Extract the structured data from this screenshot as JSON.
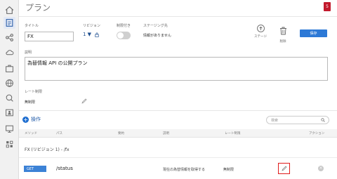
{
  "header": {
    "title": "プラン",
    "notification_count": "5"
  },
  "nav": {
    "items": [
      "home-icon",
      "plan-icon",
      "share-icon",
      "cloud-icon",
      "bag-icon",
      "globe-icon",
      "search-person-icon",
      "user-card-icon",
      "monitor-icon",
      "puzzle-icon"
    ]
  },
  "form": {
    "title_label": "タイトル",
    "title_value": "FX",
    "revision_label": "リビジョン",
    "revision_value": "1 ▼",
    "limited_label": "制限付き",
    "staging_label": "ステージング先",
    "staging_value": "情報がありません",
    "description_label": "説明",
    "description_value": "為替情報 API の公開プラン",
    "rate_limit_label": "レート制限",
    "rate_limit_value": "無制限"
  },
  "actions": {
    "stage": "ステージ",
    "delete": "削除",
    "save": "保存"
  },
  "operations": {
    "label": "操作",
    "search_placeholder": "検索",
    "columns": {
      "method": "メソッド",
      "path": "パス",
      "parameters": "要約",
      "description": "説明",
      "rate_limit": "レート制限",
      "actions": "アクション"
    },
    "group_title": "FX (リビジョン 1) - /fx",
    "rows": [
      {
        "method": "GET",
        "path": "/status",
        "description": "現在の為替情報を取得する",
        "rate_limit": "無制限"
      }
    ]
  }
}
